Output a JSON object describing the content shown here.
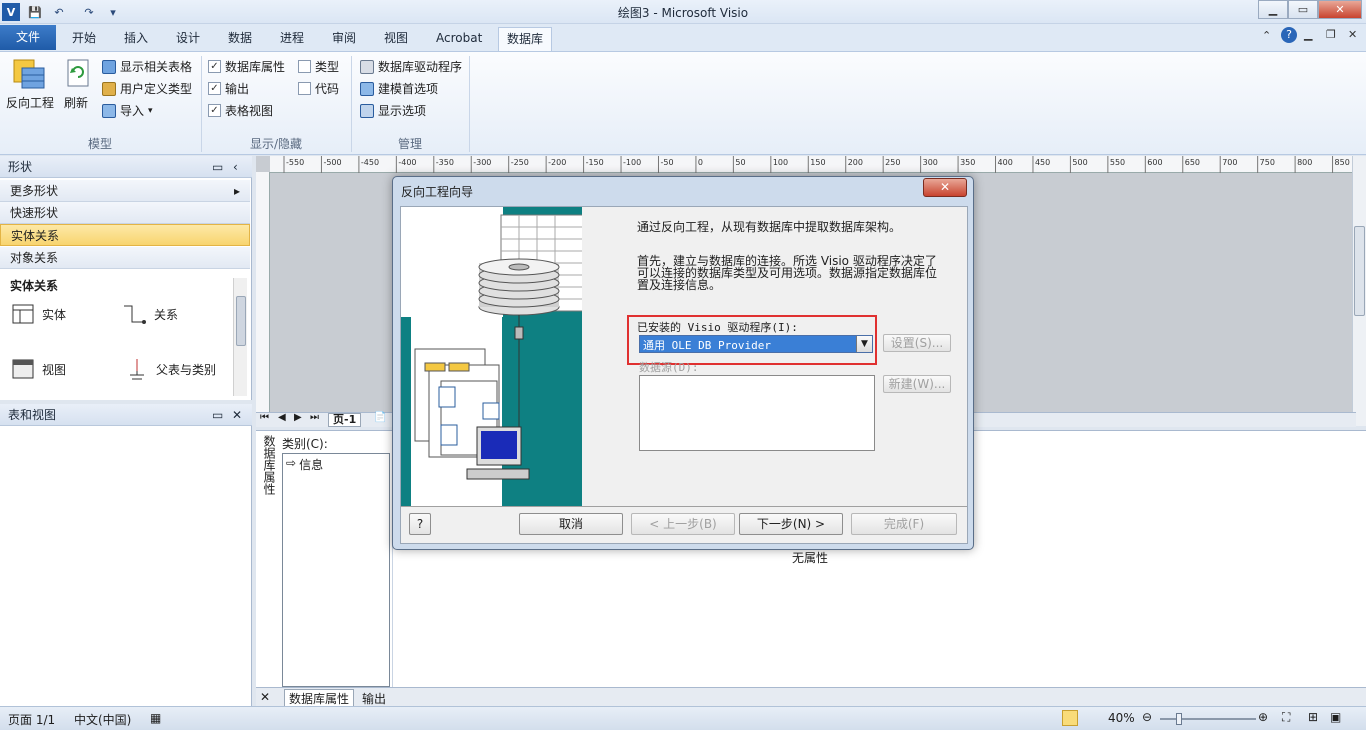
{
  "window": {
    "title": "绘图3 - Microsoft Visio"
  },
  "qat": {
    "logo": "V"
  },
  "tabs": {
    "file": "文件",
    "items": [
      "开始",
      "插入",
      "设计",
      "数据",
      "进程",
      "审阅",
      "视图",
      "Acrobat",
      "数据库"
    ]
  },
  "ribbon": {
    "model": {
      "reverse": "反向工程",
      "refresh": "刷新",
      "show_related": "显示相关表格",
      "user_types": "用户定义类型",
      "import": "导入",
      "label": "模型"
    },
    "showhide": {
      "db_props": "数据库属性",
      "output": "输出",
      "table_view": "表格视图",
      "types": "类型",
      "code": "代码",
      "label": "显示/隐藏"
    },
    "manage": {
      "drivers": "数据库驱动程序",
      "modeling": "建模首选项",
      "display": "显示选项",
      "label": "管理"
    }
  },
  "shapes_panel": {
    "title": "形状",
    "more": "更多形状",
    "quick": "快速形状",
    "er": "实体关系",
    "object": "对象关系",
    "stencil_title": "实体关系",
    "items": [
      "实体",
      "关系",
      "视图",
      "父表与类别"
    ]
  },
  "tables_panel": {
    "title": "表和视图"
  },
  "pagetabs": {
    "page": "页-1"
  },
  "dbprops": {
    "side_label": "数据库属性",
    "category_label": "类别(C):",
    "category_item": "信息",
    "no_props": "无属性",
    "tab_props": "数据库属性",
    "tab_output": "输出"
  },
  "statusbar": {
    "page": "页面 1/1",
    "lang": "中文(中国)",
    "zoom": "40%"
  },
  "dialog": {
    "title": "反向工程向导",
    "intro": "通过反向工程，从现有数据库中提取数据库架构。",
    "desc": "首先，建立与数据库的连接。所选 Visio 驱动程序决定了可以连接的数据库类型及可用选项。数据源指定数据库位置及连接信息。",
    "driver_label": "已安装的 Visio 驱动程序(I):",
    "driver_value": "通用 OLE DB Provider",
    "setup_btn": "设置(S)...",
    "datasource_label": "数据源(D):",
    "new_btn": "新建(W)...",
    "help_btn": "?",
    "cancel": "取消",
    "back": "< 上一步(B)",
    "next": "下一步(N) >",
    "finish": "完成(F)"
  },
  "ruler": {
    "ticks": [
      "-550",
      "-500",
      "-450",
      "-400",
      "-350",
      "-300",
      "-250",
      "-200",
      "-150",
      "-100",
      "-50",
      "0",
      "50",
      "100",
      "150",
      "200",
      "250",
      "300",
      "350",
      "400",
      "450",
      "500",
      "550",
      "600",
      "650",
      "700",
      "750",
      "800",
      "850"
    ]
  },
  "colors": {
    "accent": "#1f5ba8",
    "highlight": "#e03030",
    "teal": "#008080"
  }
}
